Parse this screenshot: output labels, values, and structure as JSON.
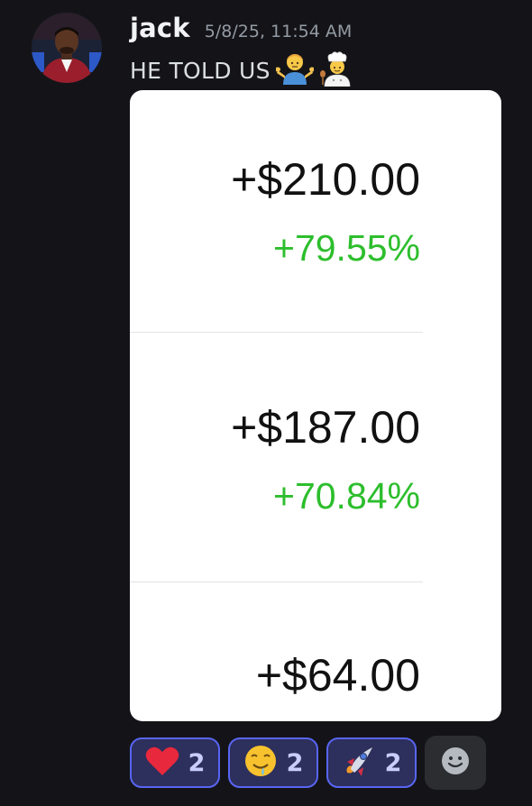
{
  "message": {
    "username": "jack",
    "timestamp": "5/8/25, 11:54 AM",
    "text": "HE TOLD US",
    "inline_emojis": [
      "man-shrugging-emoji",
      "cook-emoji"
    ]
  },
  "attachment": {
    "rows": [
      {
        "amount": "+$210.00",
        "percent": "+79.55%"
      },
      {
        "amount": "+$187.00",
        "percent": "+70.84%"
      },
      {
        "amount": "+$64.00"
      }
    ],
    "colors": {
      "gain": "#2dbe2d",
      "text": "#111111",
      "background": "#ffffff"
    }
  },
  "reactions": [
    {
      "emoji": "heart-icon",
      "count": "2"
    },
    {
      "emoji": "drooling-face-icon",
      "count": "2"
    },
    {
      "emoji": "rocket-icon",
      "count": "2"
    }
  ],
  "colors": {
    "background": "#141418",
    "username": "#f2f3f5",
    "timestamp": "#949ba4",
    "reaction_border": "#5865f2",
    "reaction_bg": "#2d2f5c"
  }
}
